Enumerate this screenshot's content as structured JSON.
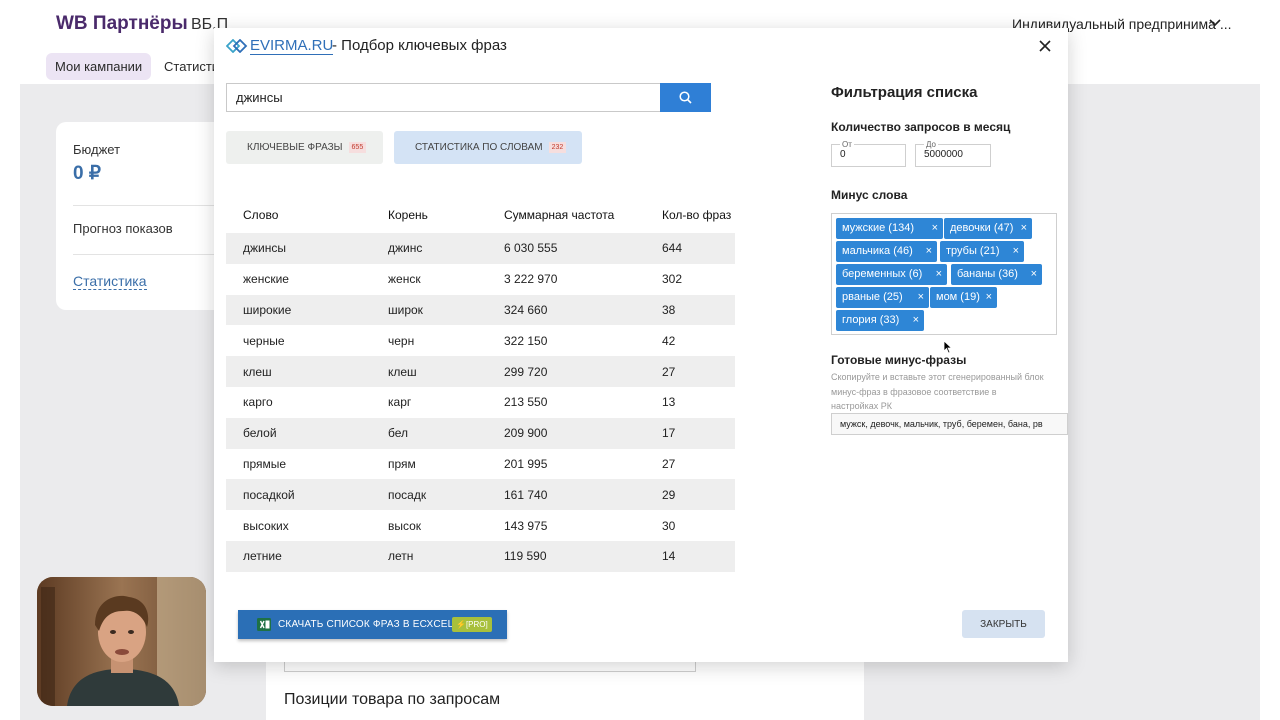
{
  "header": {
    "brand": "WB Партнёры",
    "brand_sub": "ВБ.П",
    "user": "Индивидуальный предпринима ...",
    "tabs": [
      "Мои кампании",
      "Статисти"
    ]
  },
  "stats_card": {
    "budget_label": "Бюджет",
    "budget_value": "0 ₽",
    "forecast_label": "Прогноз показов",
    "stats_link": "Статистика"
  },
  "bottom": {
    "section_title": "Позиции товара по запросам"
  },
  "modal": {
    "logo": "EVIRMA.RU",
    "title": "- Подбор ключевых фраз",
    "search_value": "джинсы",
    "tabs": [
      {
        "label": "КЛЮЧЕВЫЕ ФРАЗЫ",
        "count": "655"
      },
      {
        "label": "СТАТИСТИКА ПО СЛОВАМ",
        "count": "232"
      }
    ],
    "table": {
      "headers": [
        "Слово",
        "Корень",
        "Суммарная частота",
        "Кол-во фраз"
      ],
      "rows": [
        [
          "джинсы",
          "джинс",
          "6 030 555",
          "644"
        ],
        [
          "женские",
          "женск",
          "3 222 970",
          "302"
        ],
        [
          "широкие",
          "широк",
          "324 660",
          "38"
        ],
        [
          "черные",
          "черн",
          "322 150",
          "42"
        ],
        [
          "клеш",
          "клеш",
          "299 720",
          "27"
        ],
        [
          "карго",
          "карг",
          "213 550",
          "13"
        ],
        [
          "белой",
          "бел",
          "209 900",
          "17"
        ],
        [
          "прямые",
          "прям",
          "201 995",
          "27"
        ],
        [
          "посадкой",
          "посадк",
          "161 740",
          "29"
        ],
        [
          "высоких",
          "высок",
          "143 975",
          "30"
        ],
        [
          "летние",
          "летн",
          "119 590",
          "14"
        ]
      ]
    },
    "export_label": "СКАЧАТЬ СПИСОК ФРАЗ В ЕСХCEL",
    "export_badge": "⚡[PRO]",
    "close_label": "ЗАКРЫТЬ",
    "filter": {
      "title": "Фильтрация списка",
      "requests_label": "Количество запросов в месяц",
      "from_caption": "От",
      "from_value": "0",
      "to_caption": "До",
      "to_value": "5000000",
      "minus_label": "Минус слова",
      "tags": [
        "мужские (134)",
        "девочки (47)",
        "мальчика (46)",
        "трубы (21)",
        "беременных (6)",
        "бананы (36)",
        "рваные (25)",
        "мом (19)",
        "глория (33)"
      ],
      "ready_title": "Готовые минус-фразы",
      "ready_desc": "Скопируйте и вставьте этот сгенерированный блок минус-фраз в фразовое соответствие в настройках РК",
      "ready_value": "мужск, девочк, мальчик, труб, беремен, бана, рв"
    }
  }
}
